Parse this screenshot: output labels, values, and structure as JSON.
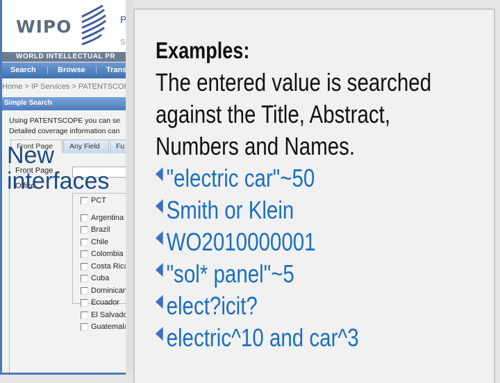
{
  "left_panel": {
    "logo": "WIPO",
    "title_fragment": "P",
    "subtitle_fragment": "S",
    "org_bar": "WORLD INTELLECTUAL PR",
    "nav": [
      "Search",
      "Browse",
      "Trans"
    ],
    "breadcrumb": "Home > IP Services > PATENTSCOPE",
    "section_title": "Simple Search",
    "intro_lines": [
      "Using PATENTSCOPE you can se",
      "Detailed coverage information can"
    ],
    "tabs": [
      "Front Page",
      "Any Field",
      "Fu"
    ],
    "field_label": "Front Page",
    "office_label": "Office",
    "offices": [
      "PCT",
      "Argentina",
      "Brazil",
      "Chile",
      "Colombia",
      "Costa Rica",
      "Cuba",
      "Dominican",
      "Ecuador",
      "El Salvador",
      "Guatemala"
    ]
  },
  "overlay": {
    "line1": "New",
    "line2": "interfaces"
  },
  "popup": {
    "heading": "Examples:",
    "description": [
      "The entered value is searched",
      "against the Title, Abstract,",
      "Numbers and Names."
    ],
    "examples": [
      "\"electric car\"~50",
      "Smith or Klein",
      "WO2010000001",
      "\"sol* panel\"~5",
      "elect?icit?",
      "electric^10 and car^3"
    ],
    "link_color": "#1a6fc0"
  }
}
